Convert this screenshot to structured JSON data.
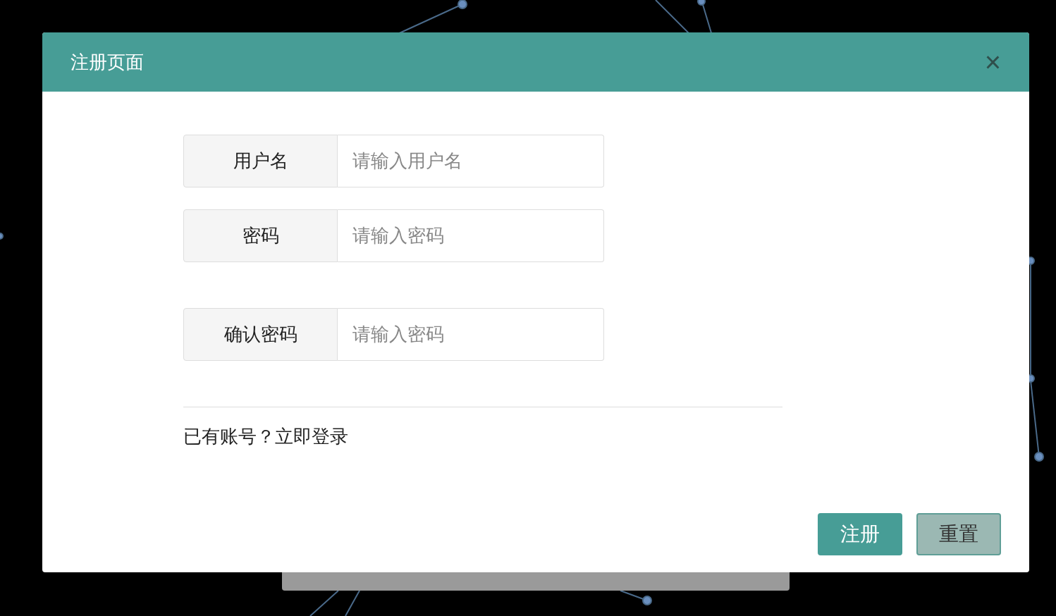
{
  "dialog": {
    "title": "注册页面",
    "close": "×"
  },
  "fields": [
    {
      "label": "用户名",
      "placeholder": "请输入用户名"
    },
    {
      "label": "密码",
      "placeholder": "请输入密码"
    },
    {
      "label": "确认密码",
      "placeholder": "请输入密码"
    }
  ],
  "login_prompt": {
    "text": "已有账号？",
    "link": "立即登录"
  },
  "buttons": [
    {
      "label": "注册",
      "kind": "primary"
    },
    {
      "label": "重置",
      "kind": "secondary"
    }
  ]
}
